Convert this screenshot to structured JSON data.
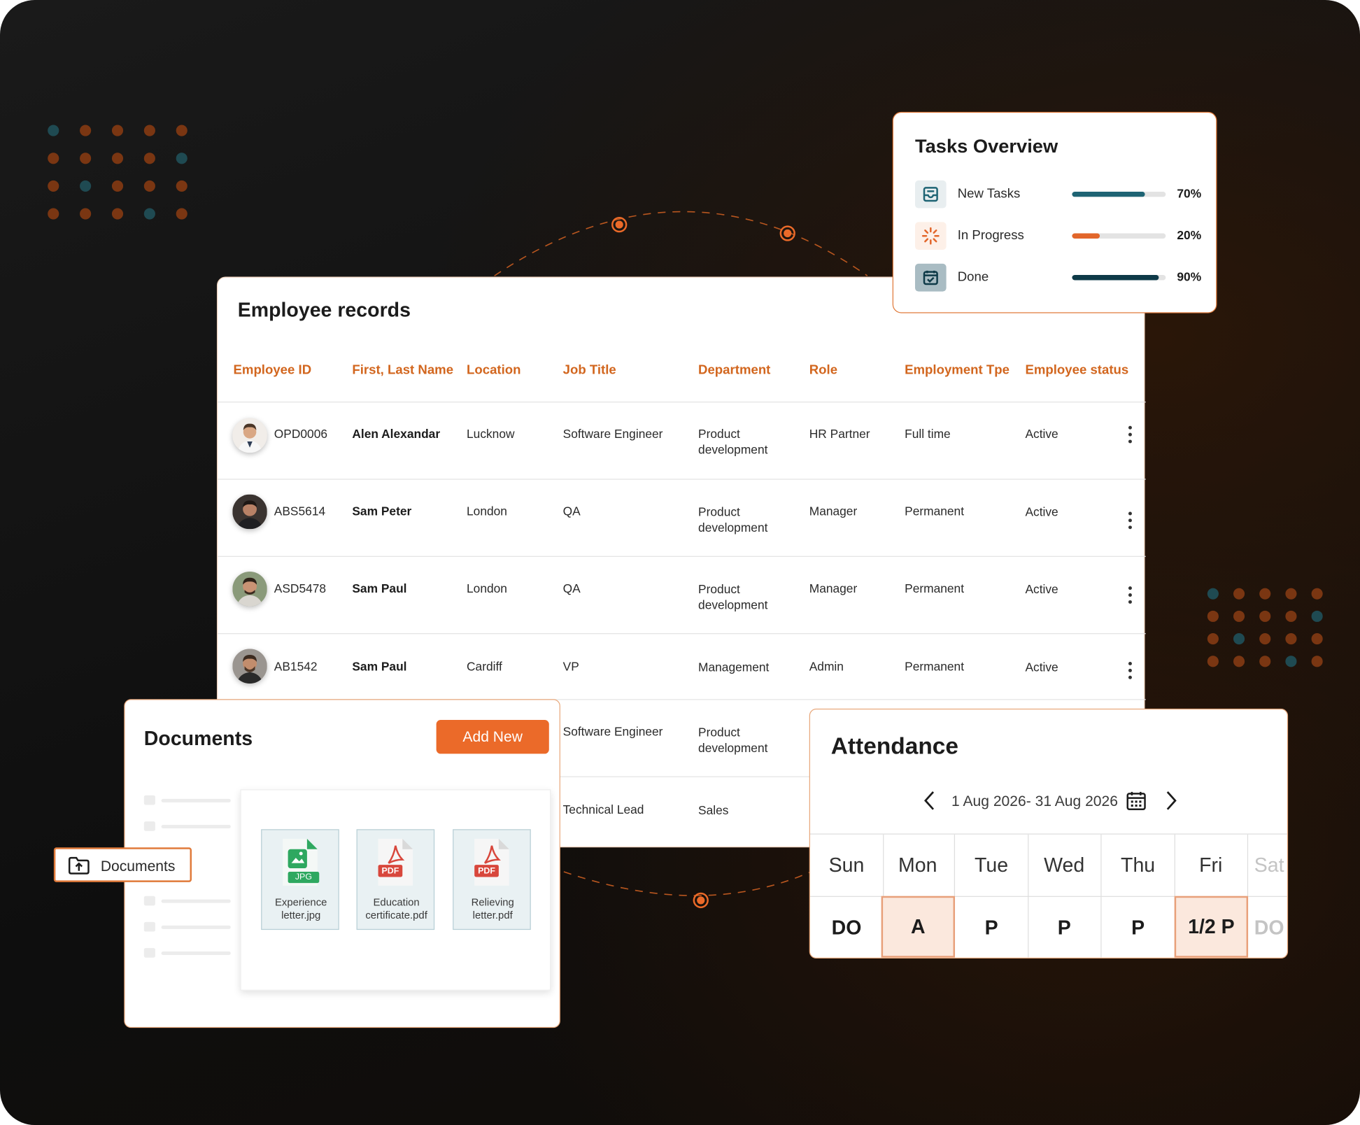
{
  "colors": {
    "accent": "#eb6a29",
    "header_text": "#d2661e",
    "teal": "#1e6474",
    "dark_teal": "#0e3a48",
    "progress_orange": "#e2662a"
  },
  "employee_records": {
    "title": "Employee records",
    "columns": [
      "Employee ID",
      "First, Last Name",
      "Location",
      "Job Title",
      "Department",
      "Role",
      "Employment Tpe",
      "Employee status"
    ],
    "rows": [
      {
        "id": "OPD0006",
        "name": "Alen Alexandar",
        "location": "Lucknow",
        "job_title": "Software Engineer",
        "department": "Product development",
        "role": "HR Partner",
        "employment_type": "Full time",
        "status": "Active"
      },
      {
        "id": "ABS5614",
        "name": "Sam Peter",
        "location": "London",
        "job_title": "QA",
        "department": "Product development",
        "role": "Manager",
        "employment_type": "Permanent",
        "status": "Active"
      },
      {
        "id": "ASD5478",
        "name": "Sam Paul",
        "location": "London",
        "job_title": "QA",
        "department": "Product development",
        "role": "Manager",
        "employment_type": "Permanent",
        "status": "Active"
      },
      {
        "id": "AB1542",
        "name": "Sam Paul",
        "location": "Cardiff",
        "job_title": "VP",
        "department": "Management",
        "role": "Admin",
        "employment_type": "Permanent",
        "status": "Active"
      },
      {
        "job_title": "Software Engineer",
        "department": "Product development"
      },
      {
        "job_title": "Technical Lead",
        "department": "Sales"
      }
    ],
    "row_menu_icon": "more-vertical-icon"
  },
  "tasks_overview": {
    "title": "Tasks Overview",
    "items": [
      {
        "label": "New Tasks",
        "percent_label": "70%",
        "value": 0.78,
        "icon": "inbox-icon",
        "color": "#1e6474"
      },
      {
        "label": "In Progress",
        "percent_label": "20%",
        "value": 0.3,
        "icon": "loader-icon",
        "color": "#e2662a"
      },
      {
        "label": "Done",
        "percent_label": "90%",
        "value": 0.93,
        "icon": "calendar-check-icon",
        "color": "#0e3a48"
      }
    ]
  },
  "documents": {
    "title": "Documents",
    "add_button": "Add New",
    "side_tab": "Documents",
    "side_tab_icon": "folder-upload-icon",
    "files": [
      {
        "badge": "JPG",
        "name_line1": "Experience",
        "name_line2": "letter.jpg",
        "icon": "image-file-icon"
      },
      {
        "badge": "PDF",
        "name_line1": "Education",
        "name_line2": "certificate.pdf",
        "icon": "pdf-file-icon"
      },
      {
        "badge": "PDF",
        "name_line1": "Relieving",
        "name_line2": "letter.pdf",
        "icon": "pdf-file-icon"
      }
    ]
  },
  "attendance": {
    "title": "Attendance",
    "range": "1 Aug 2026- 31 Aug 2026",
    "days": [
      "Sun",
      "Mon",
      "Tue",
      "Wed",
      "Thu",
      "Fri",
      "Sat"
    ],
    "values": [
      "DO",
      "A",
      "P",
      "P",
      "P",
      "1/2 P",
      "DO"
    ]
  }
}
